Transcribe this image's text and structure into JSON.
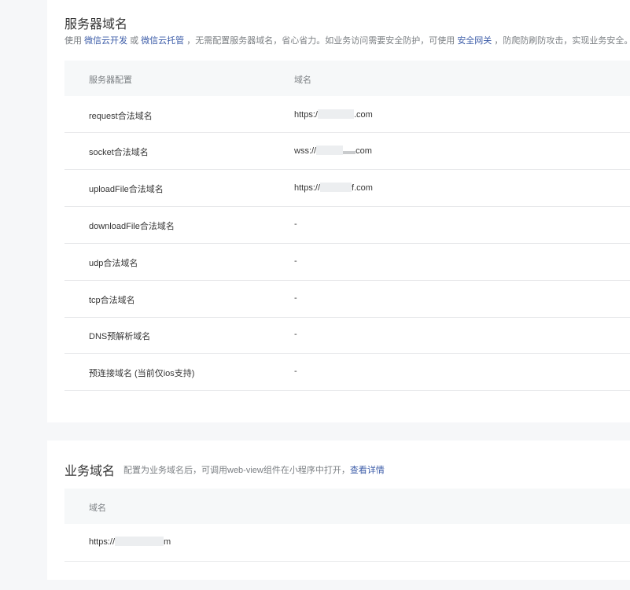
{
  "server_domains": {
    "title": "服务器域名",
    "desc_prefix": "使用",
    "desc_link1": "微信云开发",
    "desc_or": "或",
    "desc_link2": "微信云托管",
    "desc_mid": "，无需配置服务器域名，省心省力。如业务访问需要安全防护，可使用",
    "desc_link3": "安全网关",
    "desc_suffix": "，防爬防刷防攻击，实现业务安全。点击了",
    "col_config": "服务器配置",
    "col_domain": "域名",
    "rows": [
      {
        "label": "request合法域名",
        "value_prefix": "https:/",
        "value_suffix": ".com"
      },
      {
        "label": "socket合法域名",
        "value_prefix": "wss://",
        "value_suffix": "com"
      },
      {
        "label": "uploadFile合法域名",
        "value_prefix": "https://",
        "value_suffix": "f.com"
      },
      {
        "label": "downloadFile合法域名",
        "value_prefix": "-",
        "value_suffix": ""
      },
      {
        "label": "udp合法域名",
        "value_prefix": "-",
        "value_suffix": ""
      },
      {
        "label": "tcp合法域名",
        "value_prefix": "-",
        "value_suffix": ""
      },
      {
        "label": "DNS预解析域名",
        "value_prefix": "-",
        "value_suffix": ""
      },
      {
        "label": "预连接域名 (当前仅ios支持)",
        "value_prefix": "-",
        "value_suffix": ""
      }
    ]
  },
  "business_domains": {
    "title": "业务域名",
    "desc": "配置为业务域名后，可调用web-view组件在小程序中打开，",
    "desc_link": "查看详情",
    "col_domain": "域名",
    "rows": [
      {
        "value_prefix": "https://",
        "value_suffix": "m"
      }
    ]
  }
}
